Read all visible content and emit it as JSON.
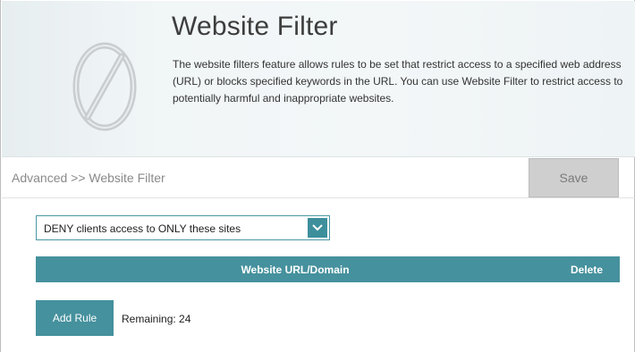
{
  "header": {
    "title": "Website Filter",
    "description": "The website filters feature allows rules to be set that restrict access to a specified web address (URL) or blocks specified keywords in the URL. You can use Website Filter to restrict access to potentially harmful and inappropriate websites.",
    "icon": "prohibited-icon"
  },
  "breadcrumb": "Advanced >> Website Filter",
  "toolbar": {
    "save_label": "Save"
  },
  "filter_mode": {
    "selected": "DENY clients access to ONLY these sites",
    "icon": "chevron-down-icon"
  },
  "table": {
    "columns": [
      "Website URL/Domain",
      "Delete"
    ],
    "rows": []
  },
  "footer": {
    "add_rule_label": "Add Rule",
    "remaining": "Remaining: 24"
  },
  "colors": {
    "accent": "#45919d",
    "save_disabled": "#cfcfcf"
  }
}
